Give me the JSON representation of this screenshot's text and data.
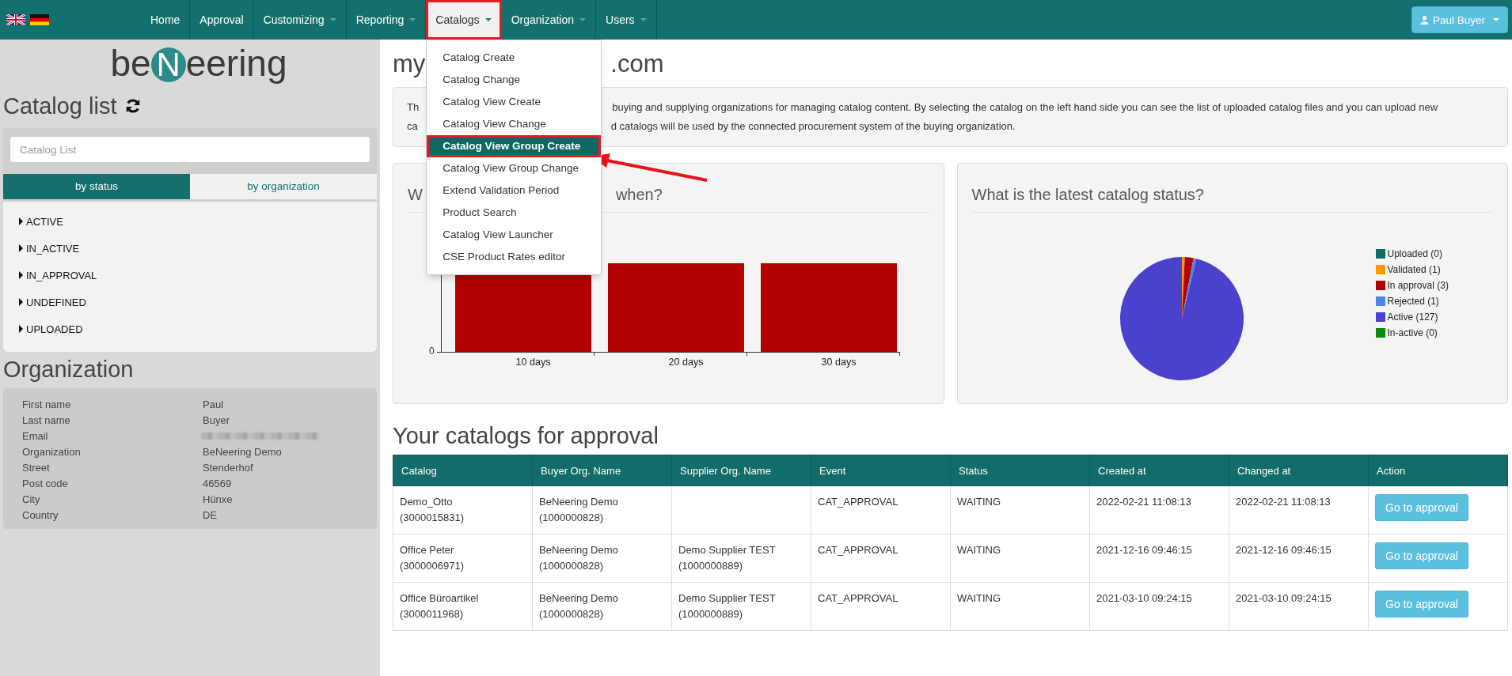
{
  "nav": {
    "items": [
      {
        "label": "Home",
        "has_menu": false,
        "selected": false
      },
      {
        "label": "Approval",
        "has_menu": false,
        "selected": false
      },
      {
        "label": "Customizing",
        "has_menu": true,
        "selected": false
      },
      {
        "label": "Reporting",
        "has_menu": true,
        "selected": false
      },
      {
        "label": "Catalogs",
        "has_menu": true,
        "selected": true
      },
      {
        "label": "Organization",
        "has_menu": true,
        "selected": false
      },
      {
        "label": "Users",
        "has_menu": true,
        "selected": false
      }
    ],
    "user_button": {
      "label": "Paul Buyer"
    }
  },
  "dropdown": {
    "items": [
      {
        "label": "Catalog Create",
        "selected": false
      },
      {
        "label": "Catalog Change",
        "selected": false
      },
      {
        "label": "Catalog View Create",
        "selected": false
      },
      {
        "label": "Catalog View Change",
        "selected": false
      },
      {
        "label": "Catalog View Group Create",
        "selected": true
      },
      {
        "label": "Catalog View Group Change",
        "selected": false
      },
      {
        "label": "Extend Validation Period",
        "selected": false
      },
      {
        "label": "Product Search",
        "selected": false
      },
      {
        "label": "Catalog View Launcher",
        "selected": false
      },
      {
        "label": "CSE Product Rates editor",
        "selected": false
      }
    ]
  },
  "sidebar": {
    "logo": {
      "before": "be",
      "mark": "N",
      "after": "eering"
    },
    "catalog_list": {
      "title": "Catalog list",
      "search": {
        "placeholder": "Catalog List"
      },
      "tabs": [
        {
          "label": "by status",
          "selected": true
        },
        {
          "label": "by organization",
          "selected": false
        }
      ],
      "statuses": [
        {
          "label": "ACTIVE",
          "expanded": false
        },
        {
          "label": "IN_ACTIVE",
          "expanded": false
        },
        {
          "label": "IN_APPROVAL",
          "expanded": false
        },
        {
          "label": "UNDEFINED",
          "expanded": false
        },
        {
          "label": "UPLOADED",
          "expanded": false
        }
      ]
    },
    "organization": {
      "title": "Organization",
      "fields": [
        {
          "label": "First name",
          "value": "Paul"
        },
        {
          "label": "Last name",
          "value": "Buyer"
        },
        {
          "label": "Email",
          "blurred": true
        },
        {
          "label": "Organization",
          "value": "BeNeering Demo"
        },
        {
          "label": "Street",
          "value": "Stenderhof"
        },
        {
          "label": "Post code",
          "value": "46569"
        },
        {
          "label": "City",
          "value": "Hünxe"
        },
        {
          "label": "Country",
          "value": "DE"
        }
      ]
    }
  },
  "main": {
    "heading": {
      "left": "my",
      "right": ".com"
    },
    "intro": {
      "lines": [
        {
          "left": "Th",
          "right": "buying and supplying organizations for managing catalog content. By selecting the catalog on the left hand side you can see the list of uploaded catalog files and you can upload new"
        },
        {
          "left": "ca",
          "right": "d catalogs will be used by the connected procurement system of the buying organization."
        }
      ]
    },
    "bar_panel": {
      "title_left": "W",
      "title_right": "when?",
      "x_labels": [
        "10 days",
        "20 days",
        "30 days"
      ],
      "y_tick": "0"
    },
    "pie_panel": {
      "title": "What is the latest catalog status?",
      "chart_data": {
        "type": "pie",
        "categories": [
          "Uploaded (0)",
          "Validated (1)",
          "In approval (3)",
          "Rejected (1)",
          "Active (127)",
          "In-active (0)"
        ],
        "series": [
          {
            "values": [
              0,
              1,
              3,
              1,
              127,
              0
            ]
          }
        ]
      },
      "legend": [
        {
          "color": "#0e6b68"
        },
        {
          "color": "#ff9900"
        },
        {
          "color": "#b00000"
        },
        {
          "color": "#4a86e8"
        },
        {
          "color": "#4a42cc"
        },
        {
          "color": "#0b8a0b"
        }
      ]
    },
    "approvals": {
      "title": "Your catalogs for approval",
      "columns": [
        "Catalog",
        "Buyer Org. Name",
        "Supplier Org. Name",
        "Event",
        "Status",
        "Created at",
        "Changed at",
        "Action"
      ],
      "rows": [
        {
          "cells": [
            "Demo_Otto\n(3000015831)",
            "BeNeering Demo\n(1000000828)",
            "",
            "CAT_APPROVAL",
            "WAITING",
            "2022-02-21 11:08:13",
            "2022-02-21 11:08:13"
          ],
          "action": "Go to approval"
        },
        {
          "cells": [
            "Office Peter\n(3000006971)",
            "BeNeering Demo\n(1000000828)",
            "Demo Supplier TEST\n(1000000889)",
            "CAT_APPROVAL",
            "WAITING",
            "2021-12-16 09:46:15",
            "2021-12-16 09:46:15"
          ],
          "action": "Go to approval"
        },
        {
          "cells": [
            "Office Büroartikel\n(3000011968)",
            "BeNeering Demo\n(1000000828)",
            "Demo Supplier TEST\n(1000000889)",
            "CAT_APPROVAL",
            "WAITING",
            "2021-03-10 09:24:15",
            "2021-03-10 09:24:15"
          ],
          "action": "Go to approval"
        }
      ]
    }
  }
}
